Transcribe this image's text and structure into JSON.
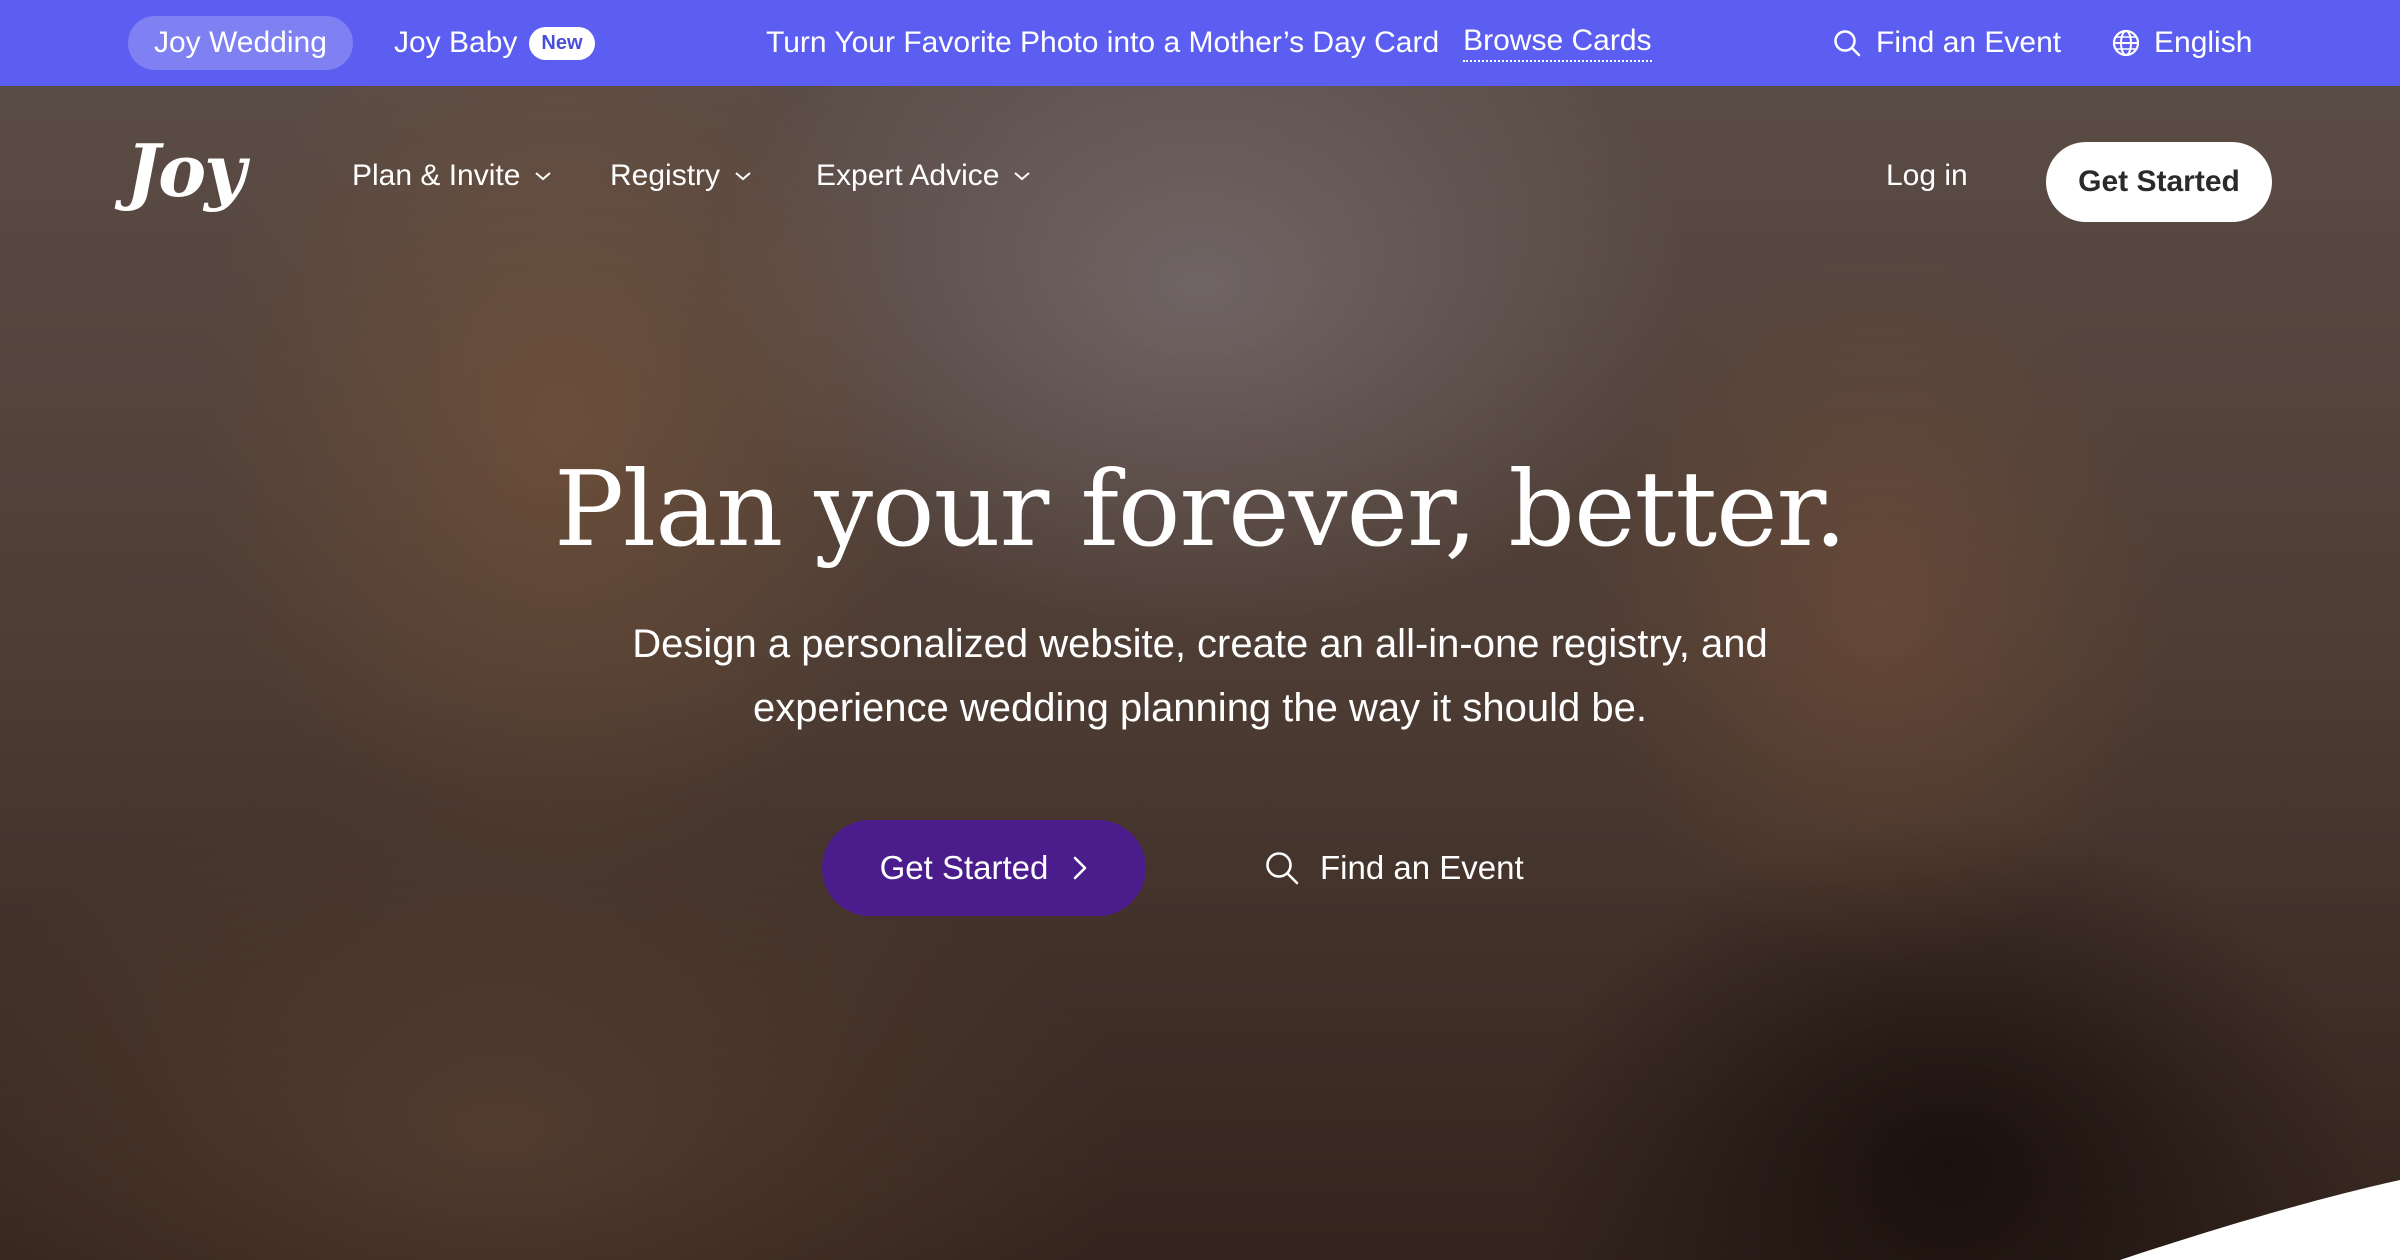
{
  "topbar": {
    "joy_wedding": "Joy Wedding",
    "joy_baby": "Joy Baby",
    "new_badge": "New",
    "promo_text": "Turn Your Favorite Photo into a Mother’s Day Card",
    "promo_link": "Browse Cards",
    "find_event": "Find an Event",
    "language": "English",
    "colors": {
      "background": "#5b5ef0"
    }
  },
  "nav": {
    "logo": "Joy",
    "items": [
      {
        "label": "Plan & Invite"
      },
      {
        "label": "Registry"
      },
      {
        "label": "Expert Advice"
      }
    ],
    "login": "Log in",
    "get_started": "Get Started"
  },
  "hero": {
    "headline": "Plan your forever, better.",
    "subtext": "Design a personalized website, create an all-in-one registry, and experience wedding planning the way it should be.",
    "primary_cta": "Get Started",
    "secondary_cta": "Find an Event",
    "colors": {
      "primary_cta": "#4a1c8c"
    }
  }
}
